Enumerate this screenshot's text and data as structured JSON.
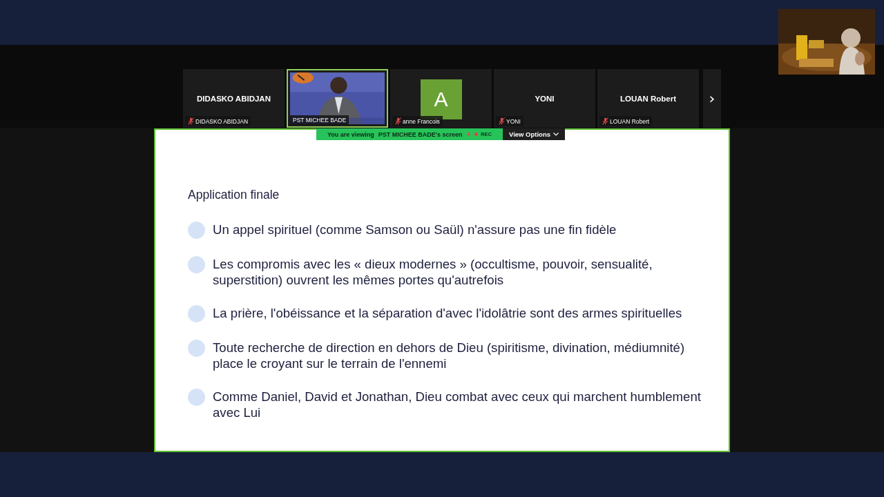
{
  "participants": [
    {
      "kind": "name",
      "name": "DIDASKO ABIDJAN",
      "label": "DIDASKO ABIDJAN",
      "muted": true,
      "speaking": false
    },
    {
      "kind": "video",
      "label": "PST MICHEE BADE",
      "muted": false,
      "speaking": true
    },
    {
      "kind": "avatar",
      "initial": "A",
      "color": "#6aa135",
      "label": "anne Francois",
      "muted": true,
      "speaking": false
    },
    {
      "kind": "name",
      "name": "YONI",
      "label": "YONI",
      "muted": true,
      "speaking": false
    },
    {
      "kind": "name",
      "name": "LOUAN Robert",
      "label": "LOUAN Robert",
      "muted": true,
      "speaking": false
    }
  ],
  "next_button": "›",
  "share_banner": {
    "prefix": "You are viewing",
    "presenter": "PST MICHEE BADE's screen",
    "presenter_muted": true,
    "recording": true,
    "rec": "REC",
    "view_options": "View Options"
  },
  "slide": {
    "title": "Application finale",
    "bullets": [
      "Un appel spirituel (comme Samson ou Saül) n'assure pas une fin fidèle",
      "Les compromis avec les « dieux modernes » (occultisme, pouvoir, sensualité, superstition) ouvrent les mêmes portes qu'autrefois",
      "La prière, l'obéissance et la séparation d'avec l'idolâtrie sont des armes spirituelles",
      "Toute recherche de direction en dehors de Dieu (spiritisme, divination, médiumnité) place le croyant sur le terrain de l'ennemi",
      "Comme Daniel, David et Jonathan, Dieu combat avec ceux qui marchent humblement avec Lui"
    ]
  }
}
